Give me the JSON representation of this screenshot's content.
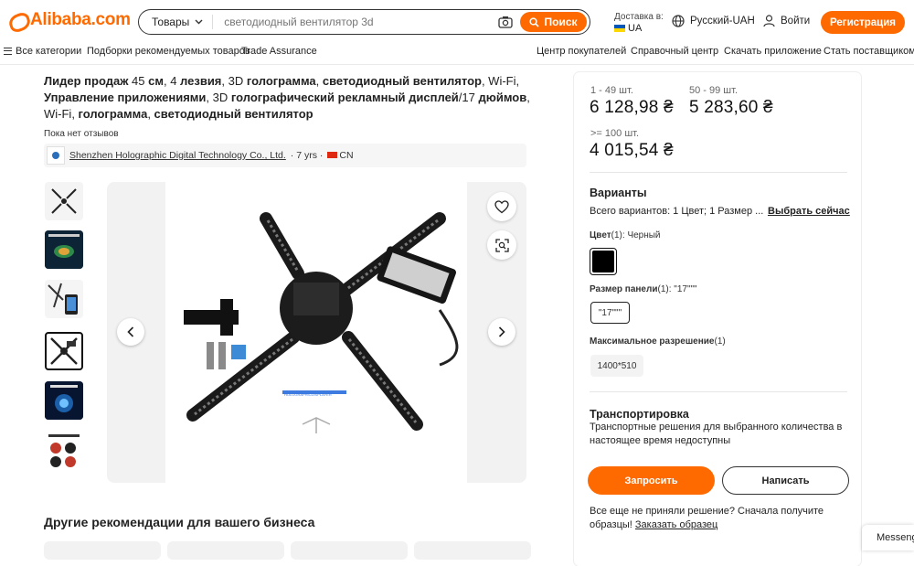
{
  "header": {
    "logo_text": "Alibaba.com",
    "search": {
      "category": "Товары",
      "placeholder": "светодиодный вентилятор 3d",
      "button": "Поиск"
    },
    "deliver": {
      "label": "Доставка в:",
      "country": "UA"
    },
    "language": "Русский-UAH",
    "login": "Войти",
    "register": "Регистрация"
  },
  "nav": {
    "left": [
      "Все категории",
      "Подборки рекомендуемых товаров",
      "Trade Assurance"
    ],
    "right": [
      "Центр покупателей",
      "Справочный центр",
      "Скачать приложение",
      "Стать поставщиком"
    ]
  },
  "product": {
    "title_parts": [
      {
        "t": "Лидер продаж",
        "b": true
      },
      {
        "t": " 45 ",
        "b": false
      },
      {
        "t": "см",
        "b": true
      },
      {
        "t": ", 4 ",
        "b": false
      },
      {
        "t": "лезвия",
        "b": true
      },
      {
        "t": ", 3D ",
        "b": false
      },
      {
        "t": "голограмма",
        "b": true
      },
      {
        "t": ", ",
        "b": false
      },
      {
        "t": "светодиодный вентилятор",
        "b": true
      },
      {
        "t": ", Wi-Fi, ",
        "b": false
      },
      {
        "t": "Управление приложениями",
        "b": true
      },
      {
        "t": ", 3D ",
        "b": false
      },
      {
        "t": "голографический рекламный дисплей",
        "b": true
      },
      {
        "t": "/17 ",
        "b": false
      },
      {
        "t": "дюймов",
        "b": true
      },
      {
        "t": ", Wi-Fi, ",
        "b": false
      },
      {
        "t": "голограмма",
        "b": true
      },
      {
        "t": ", ",
        "b": false
      },
      {
        "t": "светодиодный вентилятор",
        "b": true
      }
    ],
    "reviews": "Пока нет отзывов",
    "supplier": {
      "name": "Shenzhen Holographic Digital Technology Co., Ltd.",
      "years": "· 7 yrs ·",
      "country": "CN"
    },
    "photo_caption": "HOLOGRAPHICDISPLAYER",
    "recommendations_title": "Другие рекомендации для вашего бизнеса"
  },
  "pricing": {
    "tiers": [
      {
        "range": "1 - 49 шт.",
        "price": "6 128,98 ₴"
      },
      {
        "range": "50 - 99 шт.",
        "price": "5 283,60 ₴"
      },
      {
        "range": ">= 100 шт.",
        "price": "4 015,54 ₴"
      }
    ]
  },
  "variants": {
    "title": "Варианты",
    "summary": "Всего вариантов: 1 Цвет; 1 Размер ...",
    "select_now": "Выбрать сейчас",
    "color": {
      "label": "Цвет",
      "count": "(1):",
      "value": "Черный",
      "swatch": "#000000"
    },
    "panel_size": {
      "label": "Размер панели",
      "count": "(1):",
      "value": "\"17\"\"\"",
      "option": "\"17\"\"\""
    },
    "resolution": {
      "label": "Максимальное разрешение",
      "count": "(1)",
      "option": "1400*510"
    }
  },
  "shipping": {
    "title": "Транспортировка",
    "text": "Транспортные решения для выбранного количества в настоящее время недоступны"
  },
  "actions": {
    "request": "Запросить",
    "message": "Написать",
    "sample_text": "Все еще не приняли решение? Сначала получите образцы!",
    "sample_link": "Заказать образец"
  },
  "messenger": "Messenger",
  "colors": {
    "accent": "#ff6a00"
  }
}
